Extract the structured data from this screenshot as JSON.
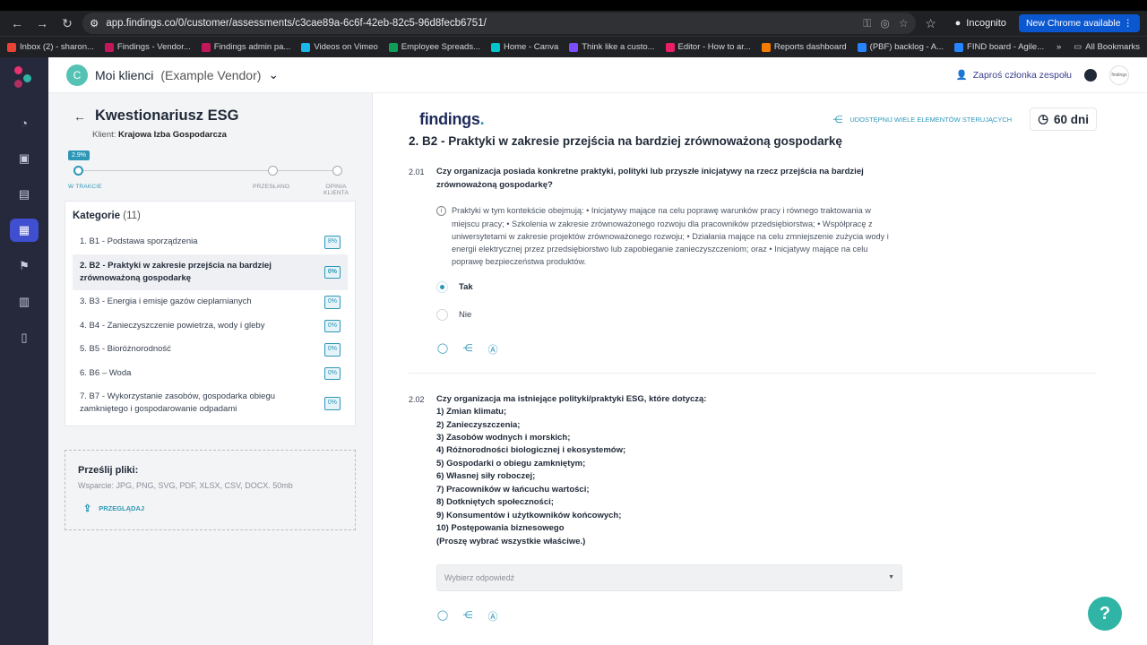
{
  "browser": {
    "url": "app.findings.co/0/customer/assessments/c3cae89a-6c6f-42eb-82c5-96d8fecb6751/",
    "incognito": "Incognito",
    "new_chrome": "New Chrome available"
  },
  "bookmarks": [
    {
      "label": "Inbox (2) - sharon...",
      "color": "#ea4335"
    },
    {
      "label": "Findings - Vendor...",
      "color": "#c2185b"
    },
    {
      "label": "Findings admin pa...",
      "color": "#c2185b"
    },
    {
      "label": "Videos on Vimeo",
      "color": "#1ab7ea"
    },
    {
      "label": "Employee Spreads...",
      "color": "#0f9d58"
    },
    {
      "label": "Home - Canva",
      "color": "#00c4cc"
    },
    {
      "label": "Think like a custo...",
      "color": "#7c4dff"
    },
    {
      "label": "Editor - How to ar...",
      "color": "#e91e63"
    },
    {
      "label": "Reports dashboard",
      "color": "#f57c00"
    },
    {
      "label": "(PBF) backlog - A...",
      "color": "#2684ff"
    },
    {
      "label": "FIND board - Agile...",
      "color": "#2684ff"
    }
  ],
  "bookmarks_all": "All Bookmarks",
  "topbar": {
    "client_name": "Moi klienci",
    "client_sub": "(Example Vendor)",
    "invite": "Zaproś członka zespołu"
  },
  "left": {
    "title": "Kwestionariusz ESG",
    "client_label": "Klient:",
    "client_value": "Krajowa Izba Gospodarcza",
    "progress_pct": "2.9%",
    "steps": [
      "W TRAKCIE",
      "PRZESŁANO",
      "OPINIA KLIENTA"
    ],
    "categories_title": "Kategorie",
    "categories_count": "(11)",
    "categories": [
      {
        "label": "1. B1 - Podstawa sporządzenia",
        "pct": "8%"
      },
      {
        "label": "2. B2 - Praktyki w zakresie przejścia na bardziej zrównoważoną gospodarkę",
        "pct": "0%"
      },
      {
        "label": "3. B3 - Energia i emisje gazów cieplarnianych",
        "pct": "0%"
      },
      {
        "label": "4. B4 - Zanieczyszczenie powietrza, wody i gleby",
        "pct": "0%"
      },
      {
        "label": "5. B5 - Bioróżnorodność",
        "pct": "0%"
      },
      {
        "label": "6. B6 – Woda",
        "pct": "0%"
      },
      {
        "label": "7. B7 - Wykorzystanie zasobów, gospodarka obiegu zamkniętego i gospodarowanie odpadami",
        "pct": "0%"
      }
    ],
    "upload_title": "Prześlij pliki:",
    "upload_support": "Wsparcie: JPG, PNG, SVG, PDF, XLSX, CSV, DOCX. 50mb",
    "browse": "PRZEGLĄDAJ"
  },
  "right": {
    "brand": "findings",
    "share_many": "UDOSTĘPNIJ WIELE ELEMENTÓW STERUJĄCYCH",
    "days": "60 dni",
    "section": "2. B2 - Praktyki w zakresie przejścia na bardziej zrównoważoną gospodarkę",
    "q1_num": "2.01",
    "q1_text": "Czy organizacja posiada konkretne praktyki, polityki lub przyszłe inicjatywy na rzecz przejścia na bardziej zrównoważoną gospodarkę?",
    "q1_hint": "Praktyki w tym kontekście obejmują: • Inicjatywy mające na celu poprawę warunków pracy i równego traktowania w miejscu pracy; • Szkolenia w zakresie zrównoważonego rozwoju dla pracowników przedsiębiorstwa; • Współpracę z uniwersytetami w zakresie projektów zrównoważonego rozwoju; • Działania mające na celu zmniejszenie zużycia wody i energii elektrycznej przez przedsiębiorstwo lub zapobieganie zanieczyszczeniom; oraz • Inicjatywy mające na celu poprawę bezpieczeństwa produktów.",
    "opt_yes": "Tak",
    "opt_no": "Nie",
    "q2_num": "2.02",
    "q2_lines": [
      "Czy organizacja ma istniejące polityki/praktyki ESG, które dotyczą:",
      "1) Zmian klimatu;",
      "2) Zanieczyszczenia;",
      "3) Zasobów wodnych i morskich;",
      "4) Różnorodności biologicznej i ekosystemów;",
      "5) Gospodarki o obiegu zamkniętym;",
      "6) Własnej siły roboczej;",
      "7) Pracowników w łańcuchu wartości;",
      "8) Dotkniętych społeczności;",
      "9) Konsumentów i użytkowników końcowych;",
      "10) Postępowania biznesowego",
      "(Proszę wybrać wszystkie właściwe.)"
    ],
    "select_placeholder": "Wybierz odpowiedź"
  }
}
